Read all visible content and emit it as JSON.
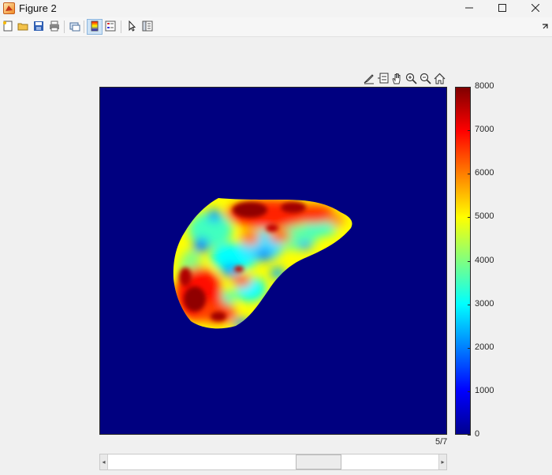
{
  "window": {
    "title": "Figure 2",
    "controls": [
      "minimize-icon",
      "maximize-icon",
      "close-icon"
    ]
  },
  "toolbar": {
    "buttons": [
      {
        "icon": "new-figure-icon",
        "active": false
      },
      {
        "icon": "open-file-icon",
        "active": false
      },
      {
        "icon": "save-icon",
        "active": false
      },
      {
        "icon": "print-icon",
        "active": false
      },
      {
        "icon": "link-plot-icon",
        "active": false
      },
      {
        "icon": "colorbar-icon",
        "active": true
      },
      {
        "icon": "legend-icon",
        "active": false
      },
      {
        "icon": "edit-plot-pointer-icon",
        "active": false
      },
      {
        "icon": "property-inspector-icon",
        "active": false
      }
    ],
    "dock_icon": "dock-arrow-icon"
  },
  "axes_toolbar": [
    "brush-icon",
    "data-tips-icon",
    "pan-hand-icon",
    "zoom-in-icon",
    "zoom-out-icon",
    "home-icon"
  ],
  "colormap": {
    "name": "jet",
    "colors": [
      "#00008f",
      "#0000ff",
      "#0080ff",
      "#00ffff",
      "#80ff80",
      "#ffff00",
      "#ff8000",
      "#ff0000",
      "#800000"
    ],
    "background": "#000080"
  },
  "colorbar": {
    "min": 0,
    "max": 8000,
    "ticks": [
      "0",
      "1000",
      "2000",
      "3000",
      "4000",
      "5000",
      "6000",
      "7000",
      "8000"
    ]
  },
  "page_indicator": "5/7",
  "slider": {
    "value": 5,
    "min": 1,
    "max": 7
  }
}
